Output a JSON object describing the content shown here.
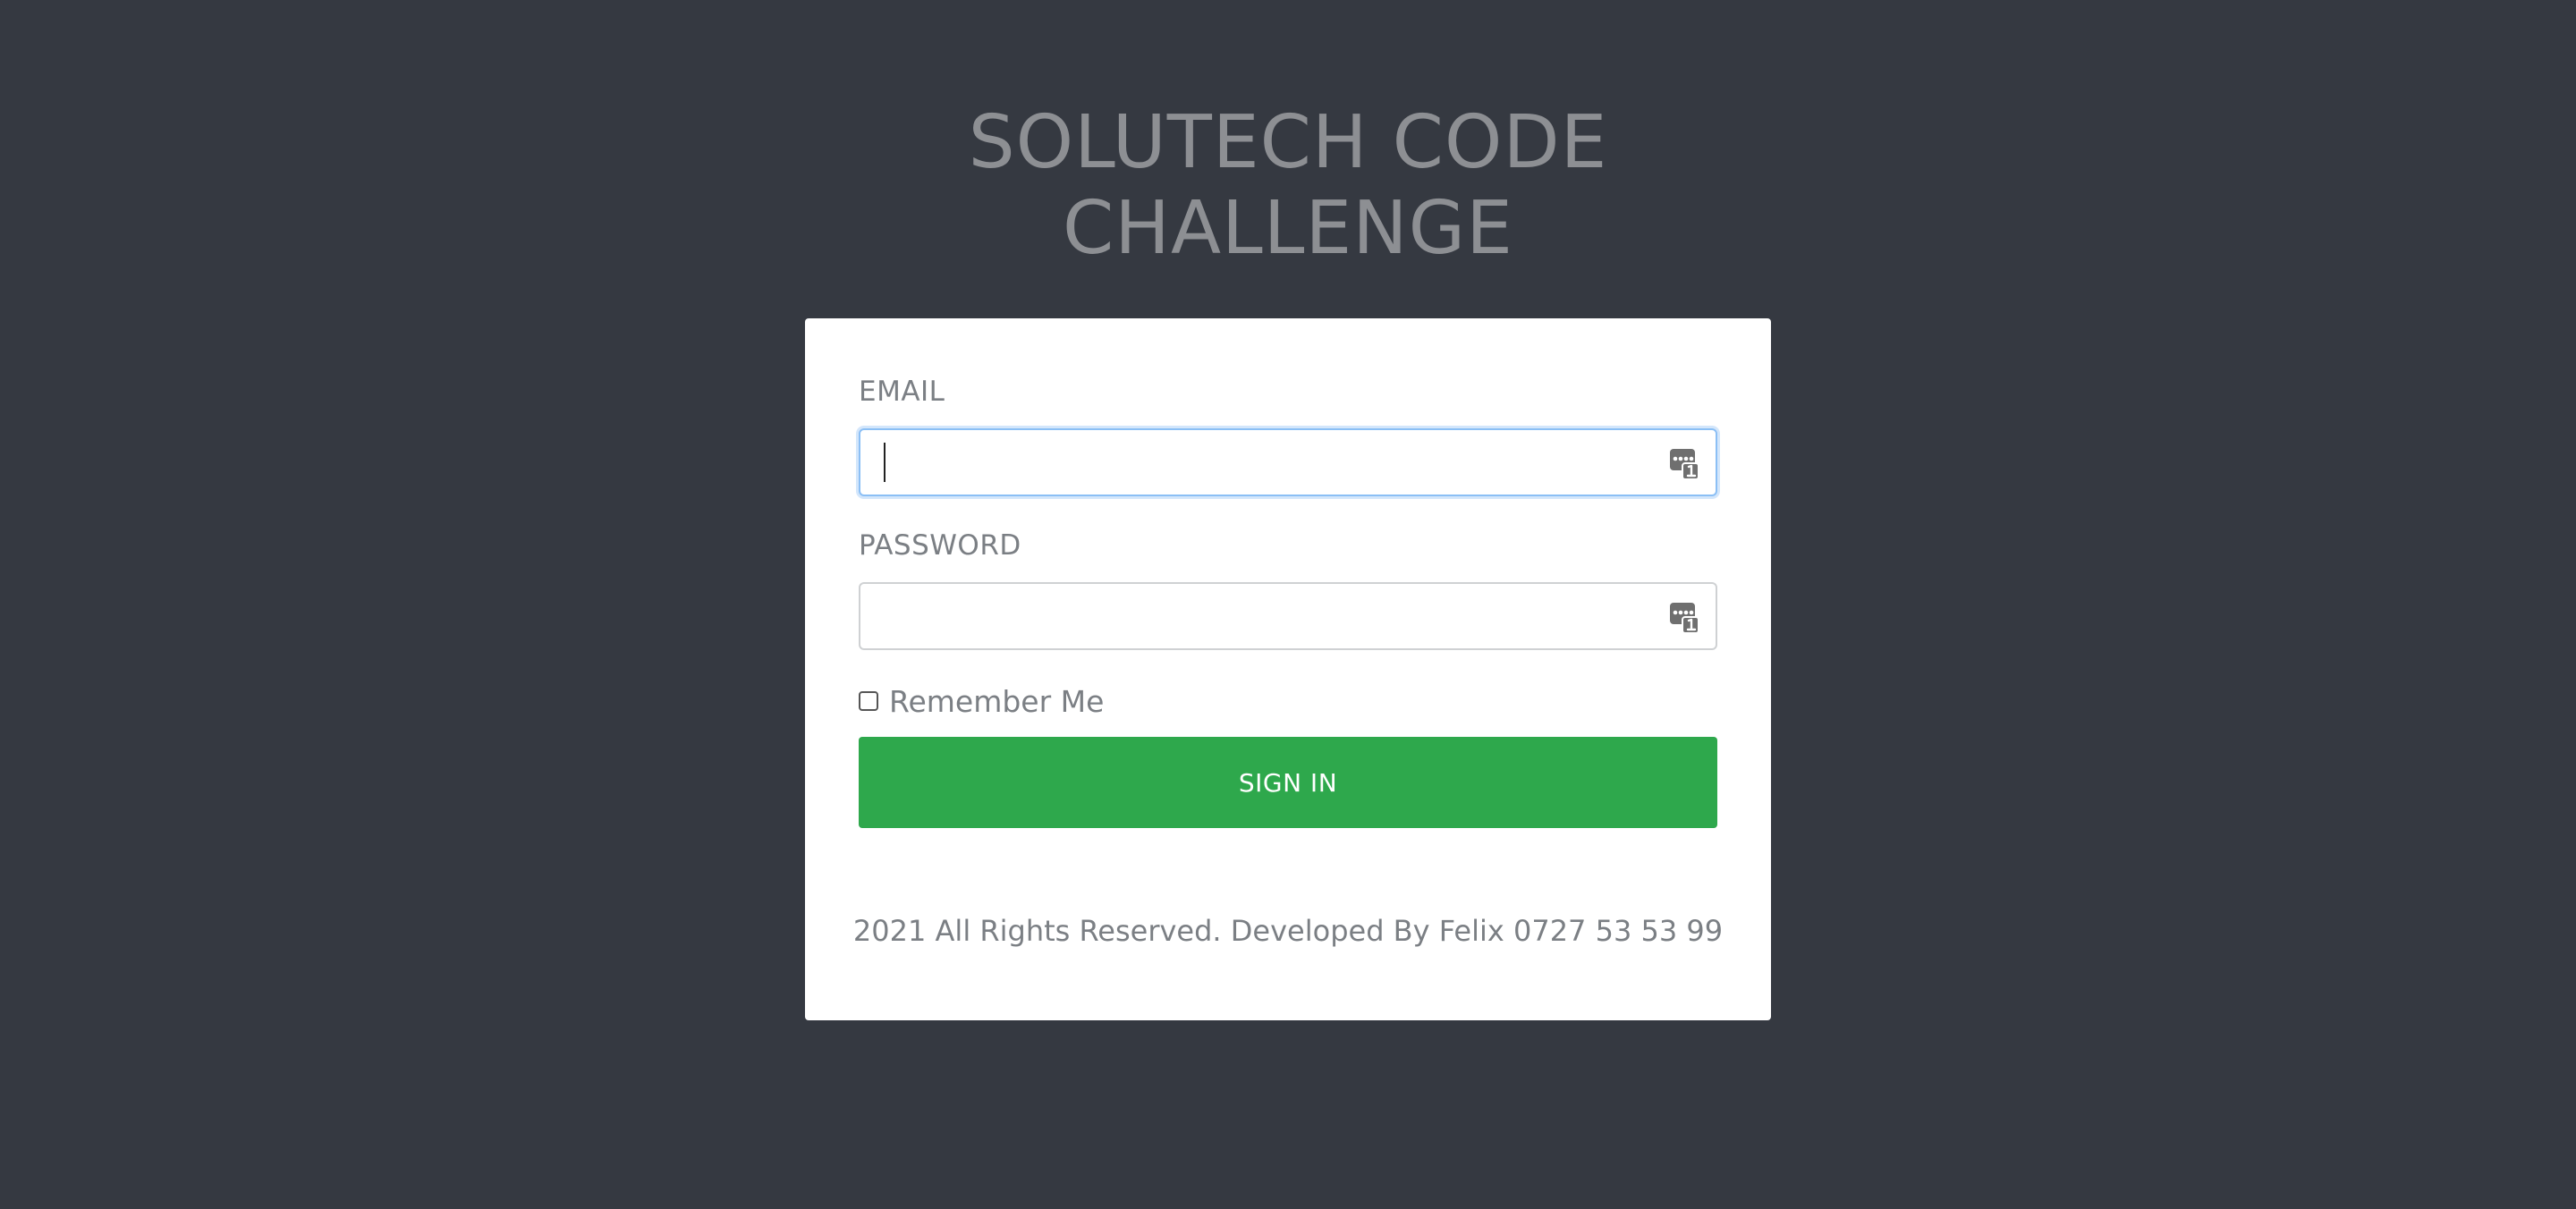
{
  "header": {
    "title_line1": "SOLUTECH CODE",
    "title_line2": "CHALLENGE"
  },
  "login_form": {
    "email_label": "EMAIL",
    "email_value": "",
    "password_label": "PASSWORD",
    "password_value": "",
    "remember_label": "Remember Me",
    "remember_checked": false,
    "submit_label": "SIGN IN",
    "autofill_icon": "password-manager-icon"
  },
  "footer": {
    "text": "2021 All Rights Reserved. Developed By Felix 0727 53 53 99"
  },
  "colors": {
    "background": "#353941",
    "card": "#ffffff",
    "primary_button": "#2ea84c",
    "focus_border": "#8bbff5",
    "muted_text": "#7b7f84"
  }
}
